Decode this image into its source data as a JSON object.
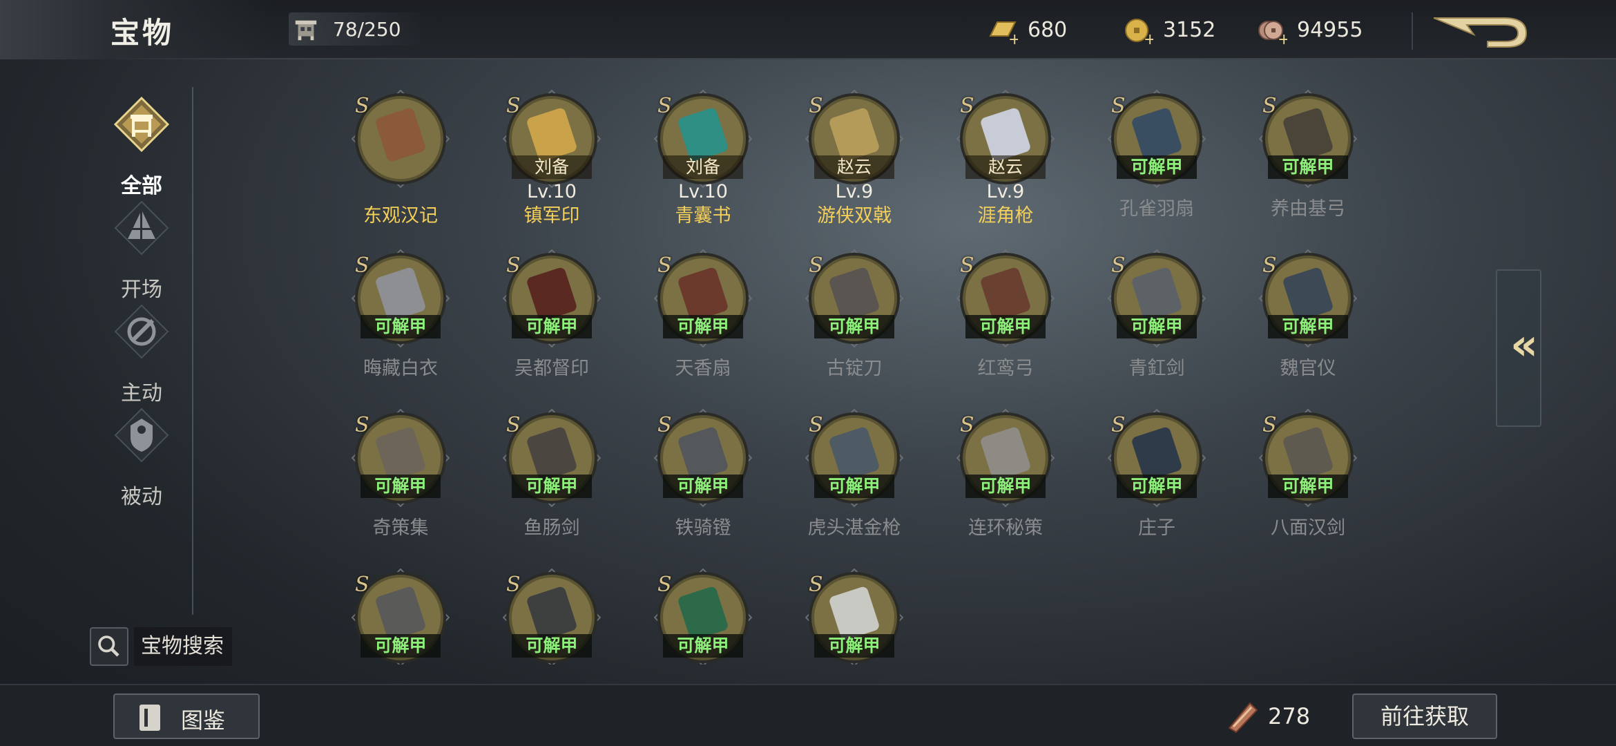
{
  "header": {
    "title": "宝物",
    "capacity": "78/250",
    "currencies": [
      {
        "icon": "gold-bar-icon",
        "value": "680"
      },
      {
        "icon": "gold-coin-icon",
        "value": "3152"
      },
      {
        "icon": "copper-coin-icon",
        "value": "94955"
      }
    ],
    "back_icon": "back-arrow-icon"
  },
  "sidenav": {
    "items": [
      {
        "label": "全部",
        "icon": "treasure-all-icon",
        "active": true
      },
      {
        "label": "开场",
        "icon": "opening-icon",
        "active": false
      },
      {
        "label": "主动",
        "icon": "active-skill-icon",
        "active": false
      },
      {
        "label": "被动",
        "icon": "passive-skill-icon",
        "active": false
      }
    ]
  },
  "search": {
    "label": "宝物搜索"
  },
  "grid": {
    "grade_letter": "S",
    "items": [
      {
        "name": "东观汉记",
        "tag": "",
        "lv": "",
        "owned": true,
        "color": "#8a5a3a"
      },
      {
        "name": "镇军印",
        "tag": "刘备",
        "lv": "Lv.10",
        "owned": true,
        "color": "#c9a24a"
      },
      {
        "name": "青囊书",
        "tag": "刘备",
        "lv": "Lv.10",
        "owned": true,
        "color": "#2f8f84"
      },
      {
        "name": "游侠双戟",
        "tag": "赵云",
        "lv": "Lv.9",
        "owned": true,
        "color": "#b59b5a"
      },
      {
        "name": "涯角枪",
        "tag": "赵云",
        "lv": "Lv.9",
        "owned": true,
        "color": "#c7ccd6"
      },
      {
        "name": "孔雀羽扇",
        "tag": "可解甲",
        "lv": "",
        "owned": false,
        "color": "#3a4e62"
      },
      {
        "name": "养由基弓",
        "tag": "可解甲",
        "lv": "",
        "owned": false,
        "color": "#4a4538"
      },
      {
        "name": "晦藏白衣",
        "tag": "可解甲",
        "lv": "",
        "owned": false,
        "color": "#8d8f92"
      },
      {
        "name": "吴都督印",
        "tag": "可解甲",
        "lv": "",
        "owned": false,
        "color": "#5a2a22"
      },
      {
        "name": "天香扇",
        "tag": "可解甲",
        "lv": "",
        "owned": false,
        "color": "#6b3a2c"
      },
      {
        "name": "古锭刀",
        "tag": "可解甲",
        "lv": "",
        "owned": false,
        "color": "#5a5550"
      },
      {
        "name": "红鸾弓",
        "tag": "可解甲",
        "lv": "",
        "owned": false,
        "color": "#6a4030"
      },
      {
        "name": "青釭剑",
        "tag": "可解甲",
        "lv": "",
        "owned": false,
        "color": "#5c6266"
      },
      {
        "name": "魏官仪",
        "tag": "可解甲",
        "lv": "",
        "owned": false,
        "color": "#3d4a56"
      },
      {
        "name": "奇策集",
        "tag": "可解甲",
        "lv": "",
        "owned": false,
        "color": "#6d6658"
      },
      {
        "name": "鱼肠剑",
        "tag": "可解甲",
        "lv": "",
        "owned": false,
        "color": "#4b4640"
      },
      {
        "name": "铁骑镫",
        "tag": "可解甲",
        "lv": "",
        "owned": false,
        "color": "#55585a"
      },
      {
        "name": "虎头湛金枪",
        "tag": "可解甲",
        "lv": "",
        "owned": false,
        "color": "#4e5a64"
      },
      {
        "name": "连环秘策",
        "tag": "可解甲",
        "lv": "",
        "owned": false,
        "color": "#8e8b84"
      },
      {
        "name": "庄子",
        "tag": "可解甲",
        "lv": "",
        "owned": false,
        "color": "#2f3b48"
      },
      {
        "name": "八面汉剑",
        "tag": "可解甲",
        "lv": "",
        "owned": false,
        "color": "#5e5a50"
      },
      {
        "name": "",
        "tag": "可解甲",
        "lv": "",
        "owned": false,
        "color": "#5a5a58"
      },
      {
        "name": "",
        "tag": "可解甲",
        "lv": "",
        "owned": false,
        "color": "#3e4040"
      },
      {
        "name": "",
        "tag": "可解甲",
        "lv": "",
        "owned": false,
        "color": "#2c6a4a"
      },
      {
        "name": "",
        "tag": "可解甲",
        "lv": "",
        "owned": false,
        "color": "#c9c9c4"
      }
    ]
  },
  "side_tab": {
    "label": "«"
  },
  "footer": {
    "codex_label": "图鉴",
    "material_count": "278",
    "obtain_label": "前往获取"
  }
}
